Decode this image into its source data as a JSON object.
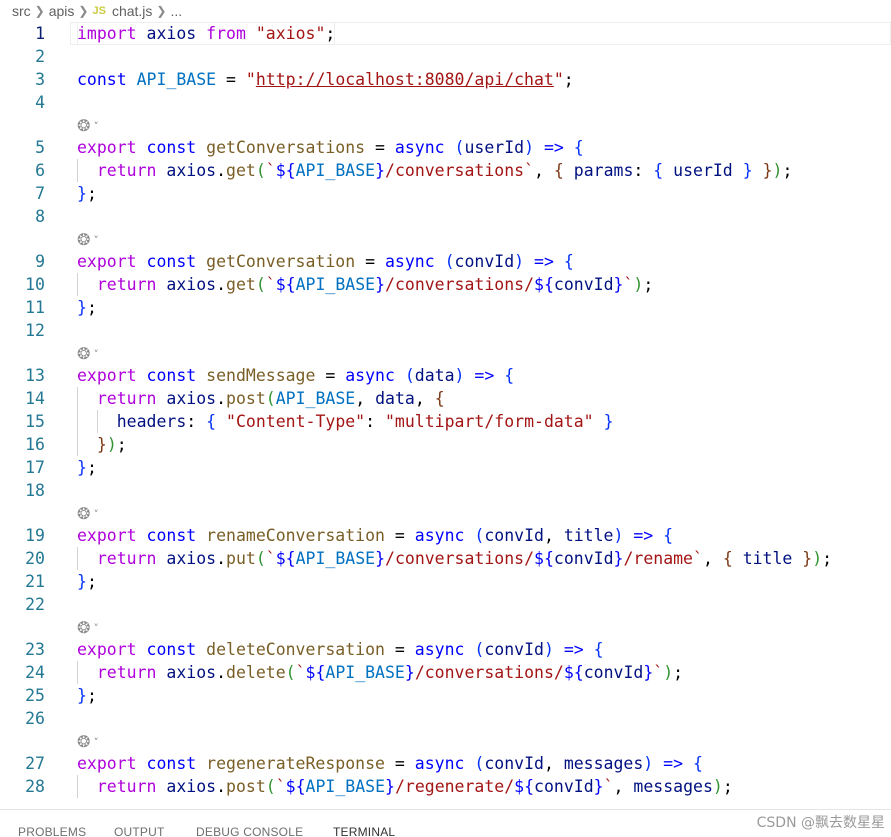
{
  "breadcrumb": {
    "items": [
      "src",
      "apis",
      "chat.js",
      "..."
    ],
    "file_badge": "JS"
  },
  "editor": {
    "lines": [
      {
        "n": "1",
        "tokens": [
          [
            "import",
            "kw2"
          ],
          [
            " axios ",
            "var"
          ],
          [
            "from",
            "kw2"
          ],
          [
            " ",
            ""
          ],
          [
            "\"axios\"",
            "str"
          ],
          [
            ";",
            ""
          ]
        ]
      },
      {
        "n": "2",
        "tokens": []
      },
      {
        "n": "3",
        "tokens": [
          [
            "const",
            "kw"
          ],
          [
            " ",
            ""
          ],
          [
            "API_BASE",
            "const"
          ],
          [
            " = ",
            ""
          ],
          [
            "\"",
            "str"
          ],
          [
            "http://localhost:8080/api/chat",
            "url"
          ],
          [
            "\"",
            "str"
          ],
          [
            ";",
            ""
          ]
        ]
      },
      {
        "n": "4",
        "tokens": []
      },
      {
        "n": "5",
        "tokens": [
          [
            "export",
            "kw2"
          ],
          [
            " ",
            ""
          ],
          [
            "const",
            "kw"
          ],
          [
            " ",
            ""
          ],
          [
            "getConversations",
            "fn"
          ],
          [
            " = ",
            ""
          ],
          [
            "async",
            "kw"
          ],
          [
            " ",
            ""
          ],
          [
            "(",
            "b1"
          ],
          [
            "userId",
            "var"
          ],
          [
            ")",
            "b1"
          ],
          [
            " ",
            ""
          ],
          [
            "=>",
            "kw"
          ],
          [
            " ",
            ""
          ],
          [
            "{",
            "b1"
          ]
        ]
      },
      {
        "n": "6",
        "tokens": [
          [
            "  ",
            ""
          ],
          [
            "return",
            "kw2"
          ],
          [
            " ",
            ""
          ],
          [
            "axios",
            "var"
          ],
          [
            ".",
            ""
          ],
          [
            "get",
            "fn"
          ],
          [
            "(",
            "b2"
          ],
          [
            "`",
            "str"
          ],
          [
            "${",
            "kw"
          ],
          [
            "API_BASE",
            "const"
          ],
          [
            "}",
            "kw"
          ],
          [
            "/conversations`",
            "str"
          ],
          [
            ", ",
            ""
          ],
          [
            "{",
            "b3"
          ],
          [
            " ",
            ""
          ],
          [
            "params",
            "var"
          ],
          [
            ": ",
            ""
          ],
          [
            "{",
            "b1"
          ],
          [
            " ",
            ""
          ],
          [
            "userId",
            "var"
          ],
          [
            " ",
            ""
          ],
          [
            "}",
            "b1"
          ],
          [
            " ",
            ""
          ],
          [
            "}",
            "b3"
          ],
          [
            ")",
            "b2"
          ],
          [
            ";",
            ""
          ]
        ]
      },
      {
        "n": "7",
        "tokens": [
          [
            "}",
            "b1"
          ],
          [
            ";",
            ""
          ]
        ]
      },
      {
        "n": "8",
        "tokens": []
      },
      {
        "n": "9",
        "tokens": [
          [
            "export",
            "kw2"
          ],
          [
            " ",
            ""
          ],
          [
            "const",
            "kw"
          ],
          [
            " ",
            ""
          ],
          [
            "getConversation",
            "fn"
          ],
          [
            " = ",
            ""
          ],
          [
            "async",
            "kw"
          ],
          [
            " ",
            ""
          ],
          [
            "(",
            "b1"
          ],
          [
            "convId",
            "var"
          ],
          [
            ")",
            "b1"
          ],
          [
            " ",
            ""
          ],
          [
            "=>",
            "kw"
          ],
          [
            " ",
            ""
          ],
          [
            "{",
            "b1"
          ]
        ]
      },
      {
        "n": "10",
        "tokens": [
          [
            "  ",
            ""
          ],
          [
            "return",
            "kw2"
          ],
          [
            " ",
            ""
          ],
          [
            "axios",
            "var"
          ],
          [
            ".",
            ""
          ],
          [
            "get",
            "fn"
          ],
          [
            "(",
            "b2"
          ],
          [
            "`",
            "str"
          ],
          [
            "${",
            "kw"
          ],
          [
            "API_BASE",
            "const"
          ],
          [
            "}",
            "kw"
          ],
          [
            "/conversations/",
            "str"
          ],
          [
            "${",
            "kw"
          ],
          [
            "convId",
            "var"
          ],
          [
            "}",
            "kw"
          ],
          [
            "`",
            "str"
          ],
          [
            ")",
            "b2"
          ],
          [
            ";",
            ""
          ]
        ]
      },
      {
        "n": "11",
        "tokens": [
          [
            "}",
            "b1"
          ],
          [
            ";",
            ""
          ]
        ]
      },
      {
        "n": "12",
        "tokens": []
      },
      {
        "n": "13",
        "tokens": [
          [
            "export",
            "kw2"
          ],
          [
            " ",
            ""
          ],
          [
            "const",
            "kw"
          ],
          [
            " ",
            ""
          ],
          [
            "sendMessage",
            "fn"
          ],
          [
            " = ",
            ""
          ],
          [
            "async",
            "kw"
          ],
          [
            " ",
            ""
          ],
          [
            "(",
            "b1"
          ],
          [
            "data",
            "var"
          ],
          [
            ")",
            "b1"
          ],
          [
            " ",
            ""
          ],
          [
            "=>",
            "kw"
          ],
          [
            " ",
            ""
          ],
          [
            "{",
            "b1"
          ]
        ]
      },
      {
        "n": "14",
        "tokens": [
          [
            "  ",
            ""
          ],
          [
            "return",
            "kw2"
          ],
          [
            " ",
            ""
          ],
          [
            "axios",
            "var"
          ],
          [
            ".",
            ""
          ],
          [
            "post",
            "fn"
          ],
          [
            "(",
            "b2"
          ],
          [
            "API_BASE",
            "const"
          ],
          [
            ", ",
            ""
          ],
          [
            "data",
            "var"
          ],
          [
            ", ",
            ""
          ],
          [
            "{",
            "b3"
          ]
        ]
      },
      {
        "n": "15",
        "tokens": [
          [
            "    ",
            ""
          ],
          [
            "headers",
            "var"
          ],
          [
            ": ",
            ""
          ],
          [
            "{",
            "b1"
          ],
          [
            " ",
            ""
          ],
          [
            "\"Content-Type\"",
            "str"
          ],
          [
            ": ",
            ""
          ],
          [
            "\"multipart/form-data\"",
            "str"
          ],
          [
            " ",
            ""
          ],
          [
            "}",
            "b1"
          ]
        ]
      },
      {
        "n": "16",
        "tokens": [
          [
            "  ",
            ""
          ],
          [
            "}",
            "b3"
          ],
          [
            ")",
            "b2"
          ],
          [
            ";",
            ""
          ]
        ]
      },
      {
        "n": "17",
        "tokens": [
          [
            "}",
            "b1"
          ],
          [
            ";",
            ""
          ]
        ]
      },
      {
        "n": "18",
        "tokens": []
      },
      {
        "n": "19",
        "tokens": [
          [
            "export",
            "kw2"
          ],
          [
            " ",
            ""
          ],
          [
            "const",
            "kw"
          ],
          [
            " ",
            ""
          ],
          [
            "renameConversation",
            "fn"
          ],
          [
            " = ",
            ""
          ],
          [
            "async",
            "kw"
          ],
          [
            " ",
            ""
          ],
          [
            "(",
            "b1"
          ],
          [
            "convId",
            "var"
          ],
          [
            ", ",
            ""
          ],
          [
            "title",
            "var"
          ],
          [
            ")",
            "b1"
          ],
          [
            " ",
            ""
          ],
          [
            "=>",
            "kw"
          ],
          [
            " ",
            ""
          ],
          [
            "{",
            "b1"
          ]
        ]
      },
      {
        "n": "20",
        "tokens": [
          [
            "  ",
            ""
          ],
          [
            "return",
            "kw2"
          ],
          [
            " ",
            ""
          ],
          [
            "axios",
            "var"
          ],
          [
            ".",
            ""
          ],
          [
            "put",
            "fn"
          ],
          [
            "(",
            "b2"
          ],
          [
            "`",
            "str"
          ],
          [
            "${",
            "kw"
          ],
          [
            "API_BASE",
            "const"
          ],
          [
            "}",
            "kw"
          ],
          [
            "/conversations/",
            "str"
          ],
          [
            "${",
            "kw"
          ],
          [
            "convId",
            "var"
          ],
          [
            "}",
            "kw"
          ],
          [
            "/rename`",
            "str"
          ],
          [
            ", ",
            ""
          ],
          [
            "{",
            "b3"
          ],
          [
            " ",
            ""
          ],
          [
            "title",
            "var"
          ],
          [
            " ",
            ""
          ],
          [
            "}",
            "b3"
          ],
          [
            ")",
            "b2"
          ],
          [
            ";",
            ""
          ]
        ]
      },
      {
        "n": "21",
        "tokens": [
          [
            "}",
            "b1"
          ],
          [
            ";",
            ""
          ]
        ]
      },
      {
        "n": "22",
        "tokens": []
      },
      {
        "n": "23",
        "tokens": [
          [
            "export",
            "kw2"
          ],
          [
            " ",
            ""
          ],
          [
            "const",
            "kw"
          ],
          [
            " ",
            ""
          ],
          [
            "deleteConversation",
            "fn"
          ],
          [
            " = ",
            ""
          ],
          [
            "async",
            "kw"
          ],
          [
            " ",
            ""
          ],
          [
            "(",
            "b1"
          ],
          [
            "convId",
            "var"
          ],
          [
            ")",
            "b1"
          ],
          [
            " ",
            ""
          ],
          [
            "=>",
            "kw"
          ],
          [
            " ",
            ""
          ],
          [
            "{",
            "b1"
          ]
        ]
      },
      {
        "n": "24",
        "tokens": [
          [
            "  ",
            ""
          ],
          [
            "return",
            "kw2"
          ],
          [
            " ",
            ""
          ],
          [
            "axios",
            "var"
          ],
          [
            ".",
            ""
          ],
          [
            "delete",
            "fn"
          ],
          [
            "(",
            "b2"
          ],
          [
            "`",
            "str"
          ],
          [
            "${",
            "kw"
          ],
          [
            "API_BASE",
            "const"
          ],
          [
            "}",
            "kw"
          ],
          [
            "/conversations/",
            "str"
          ],
          [
            "${",
            "kw"
          ],
          [
            "convId",
            "var"
          ],
          [
            "}",
            "kw"
          ],
          [
            "`",
            "str"
          ],
          [
            ")",
            "b2"
          ],
          [
            ";",
            ""
          ]
        ]
      },
      {
        "n": "25",
        "tokens": [
          [
            "}",
            "b1"
          ],
          [
            ";",
            ""
          ]
        ]
      },
      {
        "n": "26",
        "tokens": []
      },
      {
        "n": "27",
        "tokens": [
          [
            "export",
            "kw2"
          ],
          [
            " ",
            ""
          ],
          [
            "const",
            "kw"
          ],
          [
            " ",
            ""
          ],
          [
            "regenerateResponse",
            "fn"
          ],
          [
            " = ",
            ""
          ],
          [
            "async",
            "kw"
          ],
          [
            " ",
            ""
          ],
          [
            "(",
            "b1"
          ],
          [
            "convId",
            "var"
          ],
          [
            ", ",
            ""
          ],
          [
            "messages",
            "var"
          ],
          [
            ")",
            "b1"
          ],
          [
            " ",
            ""
          ],
          [
            "=>",
            "kw"
          ],
          [
            " ",
            ""
          ],
          [
            "{",
            "b1"
          ]
        ]
      },
      {
        "n": "28",
        "tokens": [
          [
            "  ",
            ""
          ],
          [
            "return",
            "kw2"
          ],
          [
            " ",
            ""
          ],
          [
            "axios",
            "var"
          ],
          [
            ".",
            ""
          ],
          [
            "post",
            "fn"
          ],
          [
            "(",
            "b2"
          ],
          [
            "`",
            "str"
          ],
          [
            "${",
            "kw"
          ],
          [
            "API_BASE",
            "const"
          ],
          [
            "}",
            "kw"
          ],
          [
            "/regenerate/",
            "str"
          ],
          [
            "${",
            "kw"
          ],
          [
            "convId",
            "var"
          ],
          [
            "}",
            "kw"
          ],
          [
            "`",
            "str"
          ],
          [
            ", ",
            ""
          ],
          [
            "messages",
            "var"
          ],
          [
            ")",
            "b2"
          ],
          [
            ";",
            ""
          ]
        ]
      }
    ],
    "codelens_icon": "copilot-icon",
    "colors": {
      "keyword": "#0000ff",
      "control_keyword": "#af00db",
      "string": "#a31515",
      "function": "#795e26",
      "variable": "#001080",
      "constant": "#0070c1",
      "line_number": "#237893"
    }
  },
  "panel": {
    "tabs": [
      "PROBLEMS",
      "OUTPUT",
      "DEBUG CONSOLE",
      "TERMINAL"
    ],
    "active_tab": "TERMINAL"
  },
  "watermark": "CSDN @飘去数星星"
}
